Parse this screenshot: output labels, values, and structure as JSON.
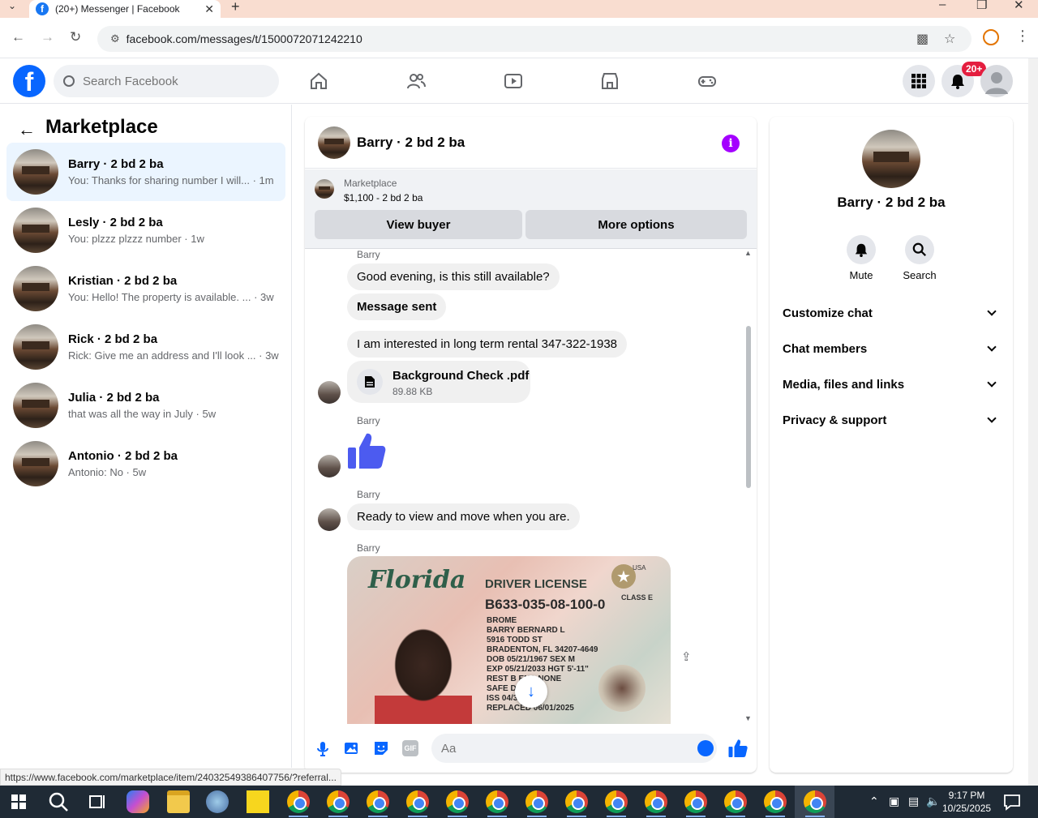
{
  "browser": {
    "tab_title": "(20+) Messenger | Facebook",
    "favicon": "f",
    "url": "facebook.com/messages/t/1500072071242210",
    "status_url": "https://www.facebook.com/marketplace/item/24032549386407756/?referral..."
  },
  "header": {
    "logo": "f",
    "search_placeholder": "Search Facebook",
    "notif_badge": "20+"
  },
  "sidebar": {
    "title": "Marketplace",
    "conversations": [
      {
        "name": "Barry · 2 bd 2 ba",
        "preview": "You: Thanks for sharing number I will... · 1m"
      },
      {
        "name": "Lesly · 2 bd 2 ba",
        "preview": "You: plzzz plzzz number · 1w"
      },
      {
        "name": "Kristian · 2 bd 2 ba",
        "preview": "You: Hello! The property is available. ... · 3w"
      },
      {
        "name": "Rick · 2 bd 2 ba",
        "preview": "Rick: Give me an address and I'll look ... · 3w"
      },
      {
        "name": "Julia · 2 bd 2 ba",
        "preview": "that was all the way in July · 5w"
      },
      {
        "name": "Antonio · 2 bd 2 ba",
        "preview": "Antonio: No · 5w"
      }
    ]
  },
  "chat": {
    "title": "Barry · 2 bd 2 ba",
    "marketplace_label": "Marketplace",
    "listing": "$1,100 - 2 bd 2 ba",
    "view_buyer": "View buyer",
    "more_options": "More options",
    "sender": "Barry",
    "messages": {
      "m1": "Good evening, is this still available?",
      "m2": "Message sent",
      "m3": "I am interested in long term rental 347-322-1938",
      "file_name": "Background Check .pdf",
      "file_size": "89.88 KB",
      "m4": "Ready to view and move when you are."
    },
    "license": {
      "state": "Florida",
      "type": "DRIVER LICENSE",
      "number": "B633-035-08-100-0",
      "lines": [
        "BROME",
        "BARRY BERNARD L",
        "5916 TODD ST",
        "BRADENTON, FL 34207-4649",
        "DOB 05/21/1967  SEX M",
        "EXP 05/21/2033  HGT 5'-11\"",
        "REST B   END NONE",
        "SAFE DRIVER",
        "ISS 04/30/2",
        "REPLACED 06/01/2025"
      ],
      "class": "CLASS E",
      "usa": "USA"
    },
    "composer_placeholder": "Aa",
    "gif_label": "GIF"
  },
  "right_panel": {
    "name": "Barry · 2 bd 2 ba",
    "mute": "Mute",
    "search": "Search",
    "rows": [
      "Customize chat",
      "Chat members",
      "Media, files and links",
      "Privacy & support"
    ]
  },
  "taskbar": {
    "time": "9:17 PM",
    "date": "10/25/2025"
  },
  "colors": {
    "fb_blue": "#0866ff",
    "info_purple": "#a400ff",
    "like_blue": "#4c5bf0",
    "badge_red": "#e41e3f"
  }
}
